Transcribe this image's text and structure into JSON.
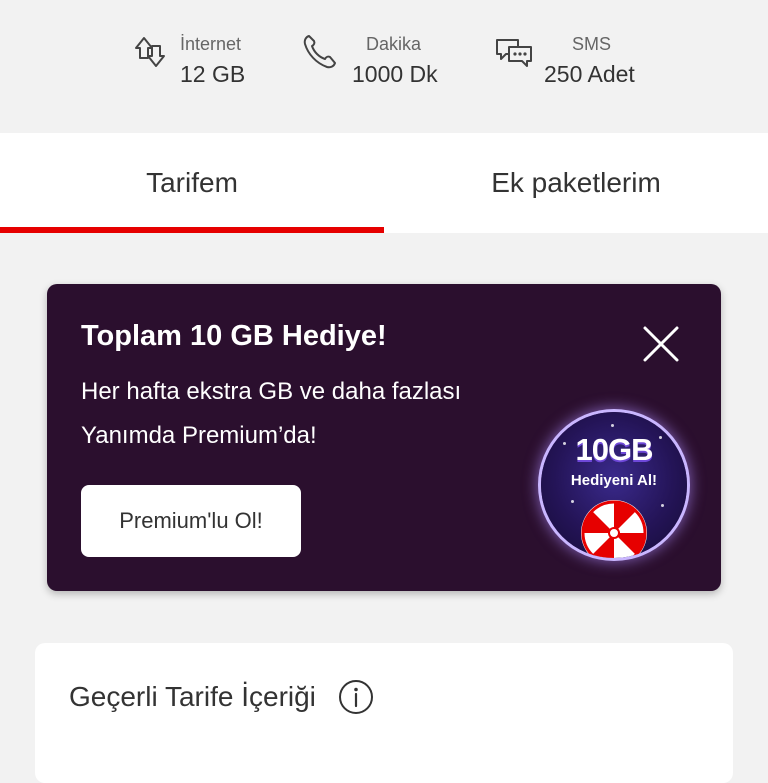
{
  "stats": {
    "internet": {
      "label": "İnternet",
      "value": "12 GB",
      "icon": "data-transfer-icon"
    },
    "dakika": {
      "label": "Dakika",
      "value": "1000 Dk",
      "icon": "phone-icon"
    },
    "sms": {
      "label": "SMS",
      "value": "250 Adet",
      "icon": "chat-bubbles-icon"
    }
  },
  "tabs": [
    {
      "label": "Tarifem",
      "active": true
    },
    {
      "label": "Ek paketlerim",
      "active": false
    }
  ],
  "promo": {
    "title": "Toplam 10 GB Hediye!",
    "line1": "Her hafta ekstra GB ve daha fazlası",
    "line2": "Yanımda Premium’da!",
    "button_label": "Premium'lu Ol!",
    "badge_main": "10GB",
    "badge_sub": "Hediyeni Al!"
  },
  "tariff": {
    "title": "Geçerli Tarife İçeriği"
  },
  "colors": {
    "accent": "#e60000",
    "promo_bg": "#2b0f2e",
    "page_bg": "#f2f2f2"
  }
}
